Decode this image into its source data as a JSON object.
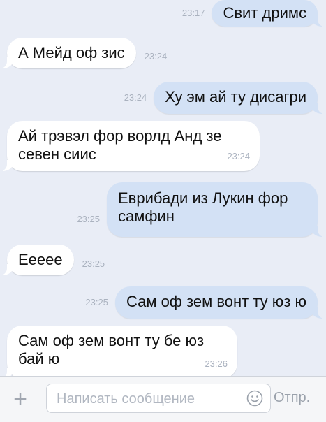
{
  "messages": [
    {
      "dir": "out",
      "text": "Свит дримс",
      "time": "23:17"
    },
    {
      "dir": "in",
      "text": "А Мейд оф зис",
      "time": "23:24"
    },
    {
      "dir": "out",
      "text": "Ху эм ай ту дисагри",
      "time": "23:24"
    },
    {
      "dir": "in",
      "text_line1": "Ай трэвэл фор ворлд Анд зе",
      "text_line2": "севен сиис",
      "time": "23:24"
    },
    {
      "dir": "out",
      "text_line1": "Еврибади из Лукин фор",
      "text_line2": "самфин",
      "time": "23:25"
    },
    {
      "dir": "in",
      "text": "Еееее",
      "time": "23:25"
    },
    {
      "dir": "out",
      "text": "Сам оф зем вонт ту юз ю",
      "time": "23:25"
    },
    {
      "dir": "in",
      "text_line1": "Сам оф зем вонт ту бе юз",
      "text_line2": "бай ю",
      "time": "23:26"
    }
  ],
  "composer": {
    "placeholder": "Написать сообщение",
    "send_label": "Отпр.",
    "plus_icon": "plus-icon",
    "emoji_icon": "smiley-icon"
  },
  "colors": {
    "background": "#e9edf6",
    "incoming_bubble": "#ffffff",
    "outgoing_bubble": "#d3e1f5",
    "timestamp": "#aab2bf"
  }
}
